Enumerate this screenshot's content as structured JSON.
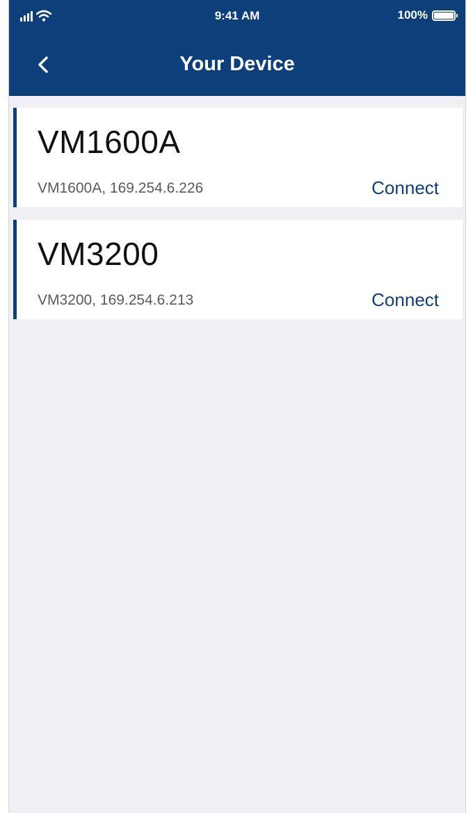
{
  "status_bar": {
    "time": "9:41 AM",
    "battery_percent": "100%",
    "icons": [
      "signal-icon",
      "wifi-icon",
      "battery-icon"
    ]
  },
  "nav": {
    "title": "Your Device",
    "back_icon": "chevron-left-icon"
  },
  "devices": [
    {
      "name": "VM1600A",
      "details": "VM1600A, 169.254.6.226",
      "action": "Connect"
    },
    {
      "name": "VM3200",
      "details": "VM3200, 169.254.6.213",
      "action": "Connect"
    }
  ],
  "colors": {
    "primary": "#0d3f7a",
    "background": "#efeff4",
    "card": "#ffffff",
    "secondary_text": "#5a5a5a"
  }
}
